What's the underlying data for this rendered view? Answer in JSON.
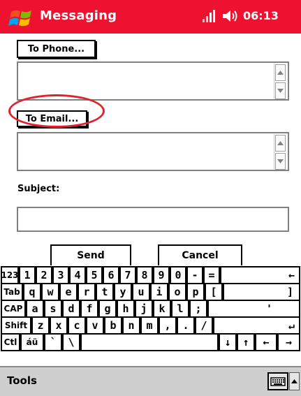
{
  "titlebar": {
    "title": "Messaging",
    "time": "06:13",
    "color": "#ee1230",
    "icons": [
      "windows-start-icon",
      "signal-icon",
      "speaker-icon"
    ]
  },
  "form": {
    "to_phone_label": "To Phone...",
    "to_email_label": "To Email...",
    "subject_label": "Subject:",
    "to_phone_value": "",
    "to_email_value": "",
    "subject_value": ""
  },
  "actions": {
    "send_label": "Send",
    "cancel_label": "Cancel"
  },
  "keyboard": {
    "rows": [
      [
        "123",
        "1",
        "2",
        "3",
        "4",
        "5",
        "6",
        "7",
        "8",
        "9",
        "0",
        "-",
        "=",
        "←"
      ],
      [
        "Tab",
        "q",
        "w",
        "e",
        "r",
        "t",
        "y",
        "u",
        "i",
        "o",
        "p",
        "[",
        "]"
      ],
      [
        "CAP",
        "a",
        "s",
        "d",
        "f",
        "g",
        "h",
        "j",
        "k",
        "l",
        ";",
        "'"
      ],
      [
        "Shift",
        "z",
        "x",
        "c",
        "v",
        "b",
        "n",
        "m",
        ",",
        ".",
        "/",
        "↵"
      ],
      [
        "Ctl",
        "áü",
        "`",
        "\\",
        "",
        "↓",
        "↑",
        "←",
        "→"
      ]
    ]
  },
  "menubar": {
    "tools_label": "Tools",
    "background": "#cfcfcf"
  },
  "highlight": {
    "color": "#e0222e",
    "target": "to-email-button"
  }
}
